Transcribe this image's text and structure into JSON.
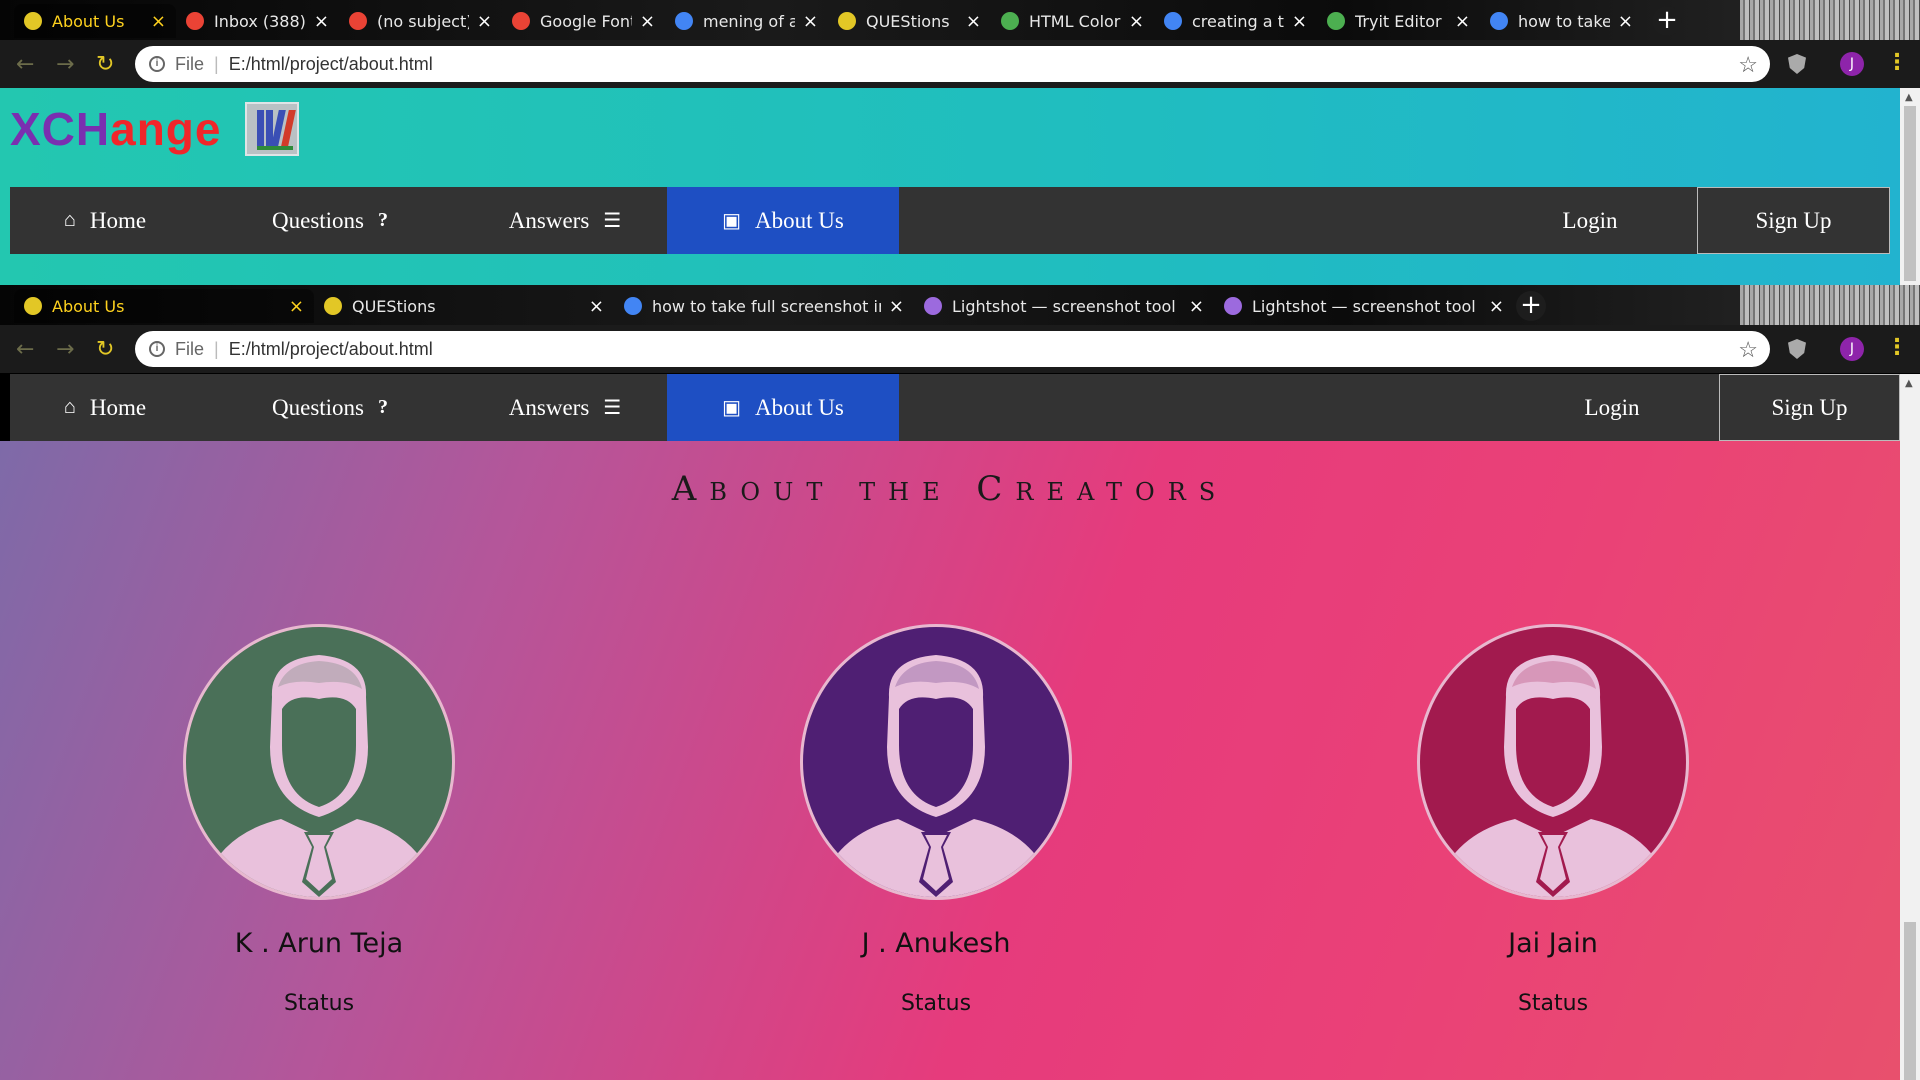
{
  "window1": {
    "tabs": [
      {
        "title": "About Us",
        "favicon": "globe-icon",
        "favicon_color": "#e2c726",
        "active": true
      },
      {
        "title": "Inbox (388) -",
        "favicon": "gmail-icon",
        "favicon_color": "#ea4335",
        "active": false
      },
      {
        "title": "(no subject)",
        "favicon": "gmail-icon",
        "favicon_color": "#ea4335",
        "active": false
      },
      {
        "title": "Google Font",
        "favicon": "fonts-icon",
        "favicon_color": "#ea4335",
        "active": false
      },
      {
        "title": "mening of a",
        "favicon": "google-icon",
        "favicon_color": "#4285f4",
        "active": false
      },
      {
        "title": "QUEStions",
        "favicon": "globe-icon",
        "favicon_color": "#e2c726",
        "active": false
      },
      {
        "title": "HTML Color",
        "favicon": "w3-icon",
        "favicon_color": "#4caf50",
        "active": false
      },
      {
        "title": "creating a te",
        "favicon": "google-icon",
        "favicon_color": "#4285f4",
        "active": false
      },
      {
        "title": "Tryit Editor",
        "favicon": "w3-icon",
        "favicon_color": "#4caf50",
        "active": false
      },
      {
        "title": "how to take",
        "favicon": "google-icon",
        "favicon_color": "#4285f4",
        "active": false
      }
    ],
    "address": {
      "scheme": "File",
      "url": "E:/html/project/about.html"
    },
    "profile_initial": "J"
  },
  "window2": {
    "tabs": [
      {
        "title": "About Us",
        "favicon": "globe-icon",
        "favicon_color": "#e2c726",
        "active": true
      },
      {
        "title": "QUEStions",
        "favicon": "globe-icon",
        "favicon_color": "#e2c726",
        "active": false
      },
      {
        "title": "how to take full screenshot in wi",
        "favicon": "google-icon",
        "favicon_color": "#4285f4",
        "active": false
      },
      {
        "title": "Lightshot — screenshot tool for M",
        "favicon": "feather-icon",
        "favicon_color": "#9c6ade",
        "active": false
      },
      {
        "title": "Lightshot — screenshot tool for M",
        "favicon": "feather-icon",
        "favicon_color": "#9c6ade",
        "active": false
      }
    ],
    "address": {
      "scheme": "File",
      "url": "E:/html/project/about.html"
    },
    "profile_initial": "J"
  },
  "site": {
    "logo_part1": "XCH",
    "logo_part2": "ange",
    "nav": {
      "home": "Home",
      "questions": "Questions",
      "answers": "Answers",
      "about": "About Us",
      "login": "Login",
      "signup": "Sign Up"
    },
    "section_title": "About the Creators",
    "creators": [
      {
        "name": "K . Arun Teja",
        "status": "Status",
        "avatar_color": "#4a7058"
      },
      {
        "name": "J . Anukesh",
        "status": "Status",
        "avatar_color": "#4f1f73"
      },
      {
        "name": "Jai Jain",
        "status": "Status",
        "avatar_color": "#a21a4e"
      }
    ]
  },
  "colors": {
    "nav_bg": "#333333",
    "nav_active": "#1e4fc3",
    "header_gradient_start": "#23c7b0",
    "header_gradient_end": "#22b3cf",
    "content_gradient_start": "#7e6aa8",
    "content_gradient_end": "#e8506d"
  }
}
